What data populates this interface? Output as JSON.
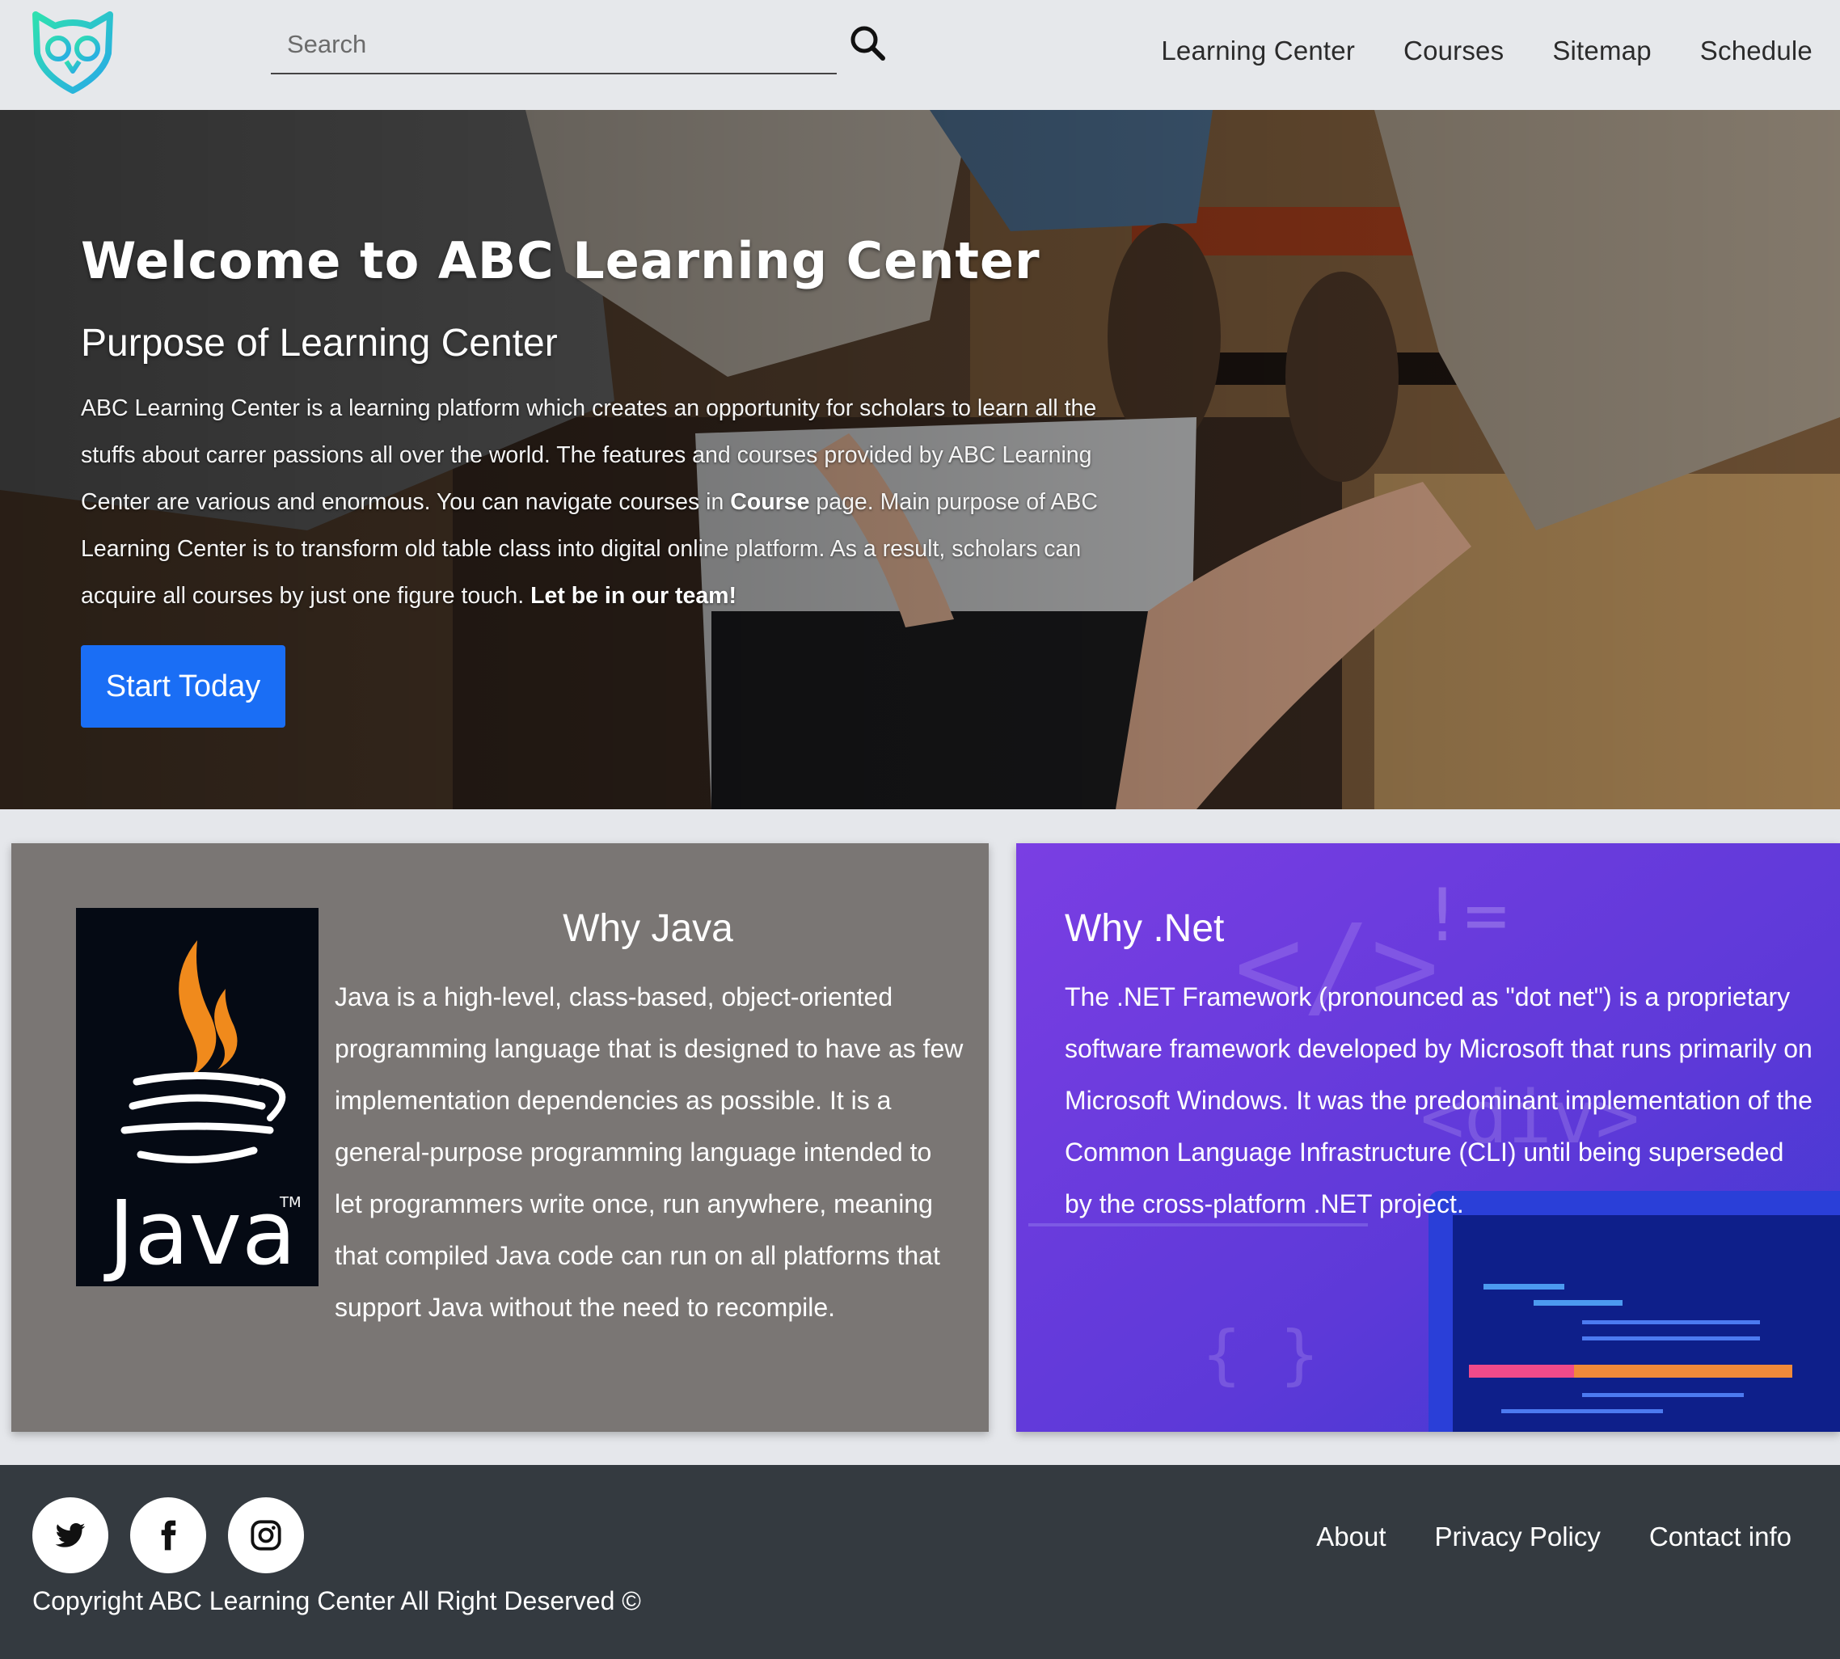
{
  "header": {
    "search_placeholder": "Search",
    "nav": [
      "Learning Center",
      "Courses",
      "Sitemap",
      "Schedule"
    ]
  },
  "hero": {
    "title": "Welcome to ABC Learning Center",
    "subtitle": "Purpose of Learning Center",
    "text_part1": "ABC Learning Center is a learning platform which creates an opportunity for scholars to learn all the stuffs about carrer passions all over the world. The features and courses provided by ABC Learning Center are various and enormous. You can navigate courses in ",
    "text_bold1": "Course",
    "text_part2": " page. Main purpose of ABC Learning Center is to transform old table class into digital online platform. As a result, scholars can acquire all courses by just one figure touch. ",
    "text_bold2": "Let be in our team!",
    "button_label": "Start Today"
  },
  "java": {
    "title": "Why Java",
    "text": "Java is a high-level, class-based, object-oriented programming language that is designed to have as few implementation dependencies as possible. It is a general-purpose programming language intended to let programmers write once, run anywhere, meaning that compiled Java code can run on all platforms that support Java without the need to recompile.",
    "logo_text": "Java",
    "logo_tm": "TM"
  },
  "dotnet": {
    "title": "Why .Net",
    "text": "The .NET Framework (pronounced as \"dot net\") is a proprietary software framework developed by Microsoft that runs primarily on Microsoft Windows. It was the predominant implementation of the Common Language Infrastructure (CLI) until being superseded by the cross-platform .NET project.",
    "decor_div": "<div>",
    "decor_braces": "{ }",
    "decor_neq": "!="
  },
  "footer": {
    "links": [
      "About",
      "Privacy Policy",
      "Contact info"
    ],
    "copyright": "Copyright ABC Learning Center All Right Deserved ©",
    "social_icons": [
      "twitter-icon",
      "facebook-icon",
      "instagram-icon"
    ]
  },
  "colors": {
    "header_bg": "#e6e8eb",
    "accent_blue": "#1a6ef5",
    "java_card_bg": "#7a7674",
    "net_card_purple": "#7b3fe0",
    "footer_bg": "#343a40",
    "logo_teal": "#2fd6c5"
  }
}
